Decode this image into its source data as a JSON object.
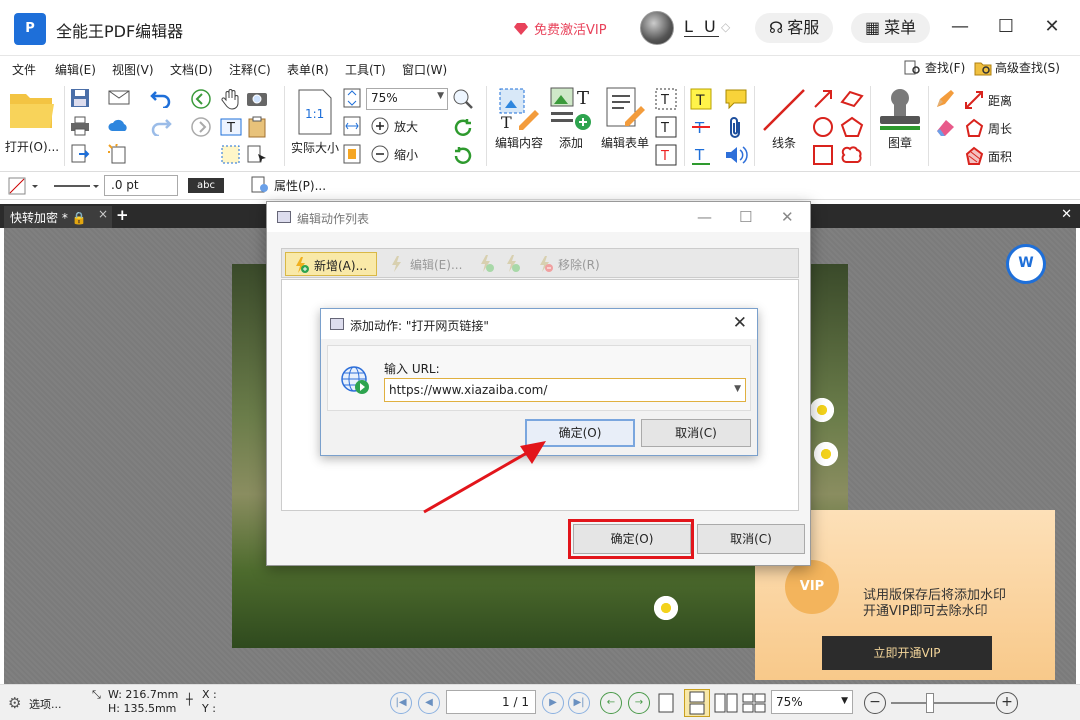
{
  "app": {
    "logo_text": "P",
    "title": "全能王PDF编辑器",
    "vip_link": "免费激活VIP",
    "username": "L U",
    "service_label": "客服",
    "menu_label": "菜单"
  },
  "menu": {
    "items": [
      "文件",
      "编辑(E)",
      "视图(V)",
      "文档(D)",
      "注释(C)",
      "表单(R)",
      "工具(T)",
      "窗口(W)"
    ],
    "find": "查找(F)",
    "advanced_find": "高级查找(S)"
  },
  "ribbon": {
    "open": "打开(O)...",
    "actual_size": "实际大小",
    "zoom_value": "75%",
    "zoom_in": "放大",
    "zoom_out": "缩小",
    "edit_content": "编辑内容",
    "add": "添加",
    "edit_form": "编辑表单",
    "lines": "线条",
    "stamp": "图章",
    "distance": "距离",
    "perimeter": "周长",
    "area": "面积"
  },
  "propbar": {
    "line_width": ".0 pt",
    "abc": "abc",
    "properties": "属性(P)..."
  },
  "tabs": {
    "doc_tab": "快转加密 *"
  },
  "dialog_actions": {
    "title": "编辑动作列表",
    "new": "新增(A)...",
    "edit": "编辑(E)...",
    "remove": "移除(R)",
    "ok": "确定(O)",
    "cancel": "取消(C)"
  },
  "dialog_add": {
    "title": "添加动作: \"打开网页链接\"",
    "url_label": "输入 URL:",
    "url_value": "https://www.xiazaiba.com/",
    "ok": "确定(O)",
    "cancel": "取消(C)"
  },
  "vip_ad": {
    "badge": "VIP",
    "line1": "试用版保存后将添加水印",
    "line2": "开通VIP即可去除水印",
    "cta": "立即开通VIP"
  },
  "statusbar": {
    "options": "选项...",
    "width": "W: 216.7mm",
    "height": "H: 135.5mm",
    "x": "X :",
    "y": "Y :",
    "page": "1 / 1",
    "zoom": "75%"
  },
  "colors": {
    "accent": "#1e6fd9",
    "vip_red": "#e8425a",
    "highlight_red": "#e2151b"
  }
}
